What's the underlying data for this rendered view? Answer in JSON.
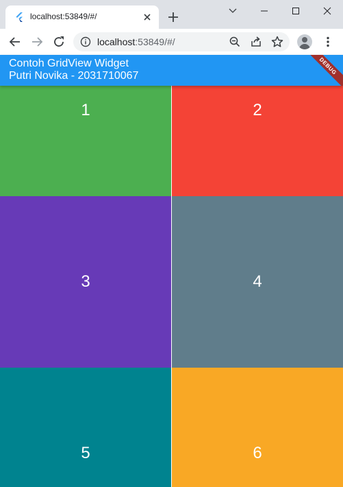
{
  "browser": {
    "tab_title": "localhost:53849/#/",
    "url_host": "localhost",
    "url_path": ":53849/#/"
  },
  "app": {
    "title_line1": "Contoh GridView Widget",
    "title_line2": "Putri Novika - 2031710067",
    "debug_banner": "DEBUG",
    "appbar_color": "#2196f3"
  },
  "grid": {
    "items": [
      {
        "label": "1",
        "color": "#4caf50"
      },
      {
        "label": "2",
        "color": "#f44336"
      },
      {
        "label": "3",
        "color": "#673ab7"
      },
      {
        "label": "4",
        "color": "#607d8b"
      },
      {
        "label": "5",
        "color": "#00838f"
      },
      {
        "label": "6",
        "color": "#f9a825"
      }
    ]
  }
}
